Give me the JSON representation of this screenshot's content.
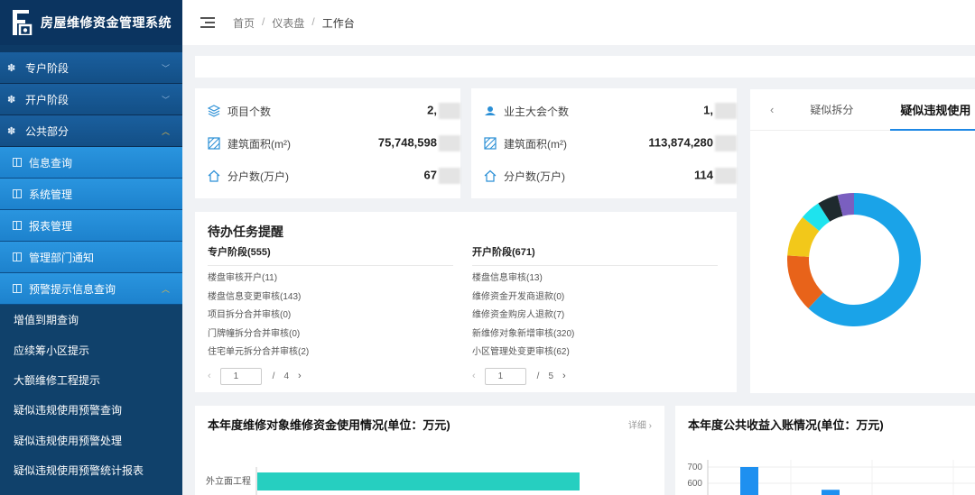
{
  "app": {
    "title": "房屋维修资金管理系统"
  },
  "colors": {
    "primary": "#1e88e5",
    "sidebar": "#10416b",
    "menu_active": "#2a95df",
    "bar_teal": "#26cfc0"
  },
  "sidebar": {
    "top_items": [
      {
        "label": "专户阶段",
        "icon": "gear-icon"
      },
      {
        "label": "开户阶段",
        "icon": "gear-icon"
      },
      {
        "label": "公共部分",
        "icon": "gear-icon",
        "expanded": true
      }
    ],
    "sub_items": [
      {
        "label": "信息查询"
      },
      {
        "label": "系统管理"
      },
      {
        "label": "报表管理"
      },
      {
        "label": "管理部门通知"
      },
      {
        "label": "预警提示信息查询",
        "expanded": true
      }
    ],
    "leaf_items": [
      {
        "label": "增值到期查询"
      },
      {
        "label": "应续筹小区提示"
      },
      {
        "label": "大额维修工程提示"
      },
      {
        "label": "疑似违规使用预警查询"
      },
      {
        "label": "疑似违规使用预警处理"
      },
      {
        "label": "疑似违规使用预警统计报表"
      }
    ]
  },
  "breadcrumb": [
    "首页",
    "仪表盘",
    "工作台"
  ],
  "stats_left": [
    {
      "label": "项目个数",
      "value": "2,",
      "icon": "layers-icon"
    },
    {
      "label": "建筑面积(m²)",
      "value": "75,748,598",
      "icon": "area-icon"
    },
    {
      "label": "分户数(万户)",
      "value": "67",
      "icon": "home-icon"
    }
  ],
  "stats_right": [
    {
      "label": "业主大会个数",
      "value": "1,",
      "icon": "group-icon"
    },
    {
      "label": "建筑面积(m²)",
      "value": "113,874,280",
      "icon": "area-icon"
    },
    {
      "label": "分户数(万户)",
      "value": "114",
      "icon": "home-icon"
    }
  ],
  "tasks": {
    "title": "待办任务提醒",
    "columns": [
      {
        "head": "专户阶段(555)",
        "items": [
          "楼盘审核开户(11)",
          "楼盘信息变更审核(143)",
          "项目拆分合并审核(0)",
          "门牌幢拆分合并审核(0)",
          "住宅单元拆分合并审核(2)"
        ],
        "page": "1",
        "sep": "/",
        "total": "4"
      },
      {
        "head": "开户阶段(671)",
        "items": [
          "楼盘信息审核(13)",
          "维修资金开发商退款(0)",
          "维修资金购房人退款(7)",
          "新维修对象新增审核(320)",
          "小区管理处变更审核(62)"
        ],
        "page": "1",
        "sep": "/",
        "total": "5"
      }
    ]
  },
  "right_panel": {
    "tabs": [
      "疑似拆分",
      "疑似违规使用"
    ],
    "active_tab": 1
  },
  "chart_data": [
    {
      "type": "pie",
      "title": "",
      "donut": true,
      "slices": [
        {
          "value": 62,
          "color": "#1aa3e8"
        },
        {
          "value": 14,
          "color": "#e8631a"
        },
        {
          "value": 10,
          "color": "#f2c81a"
        },
        {
          "value": 5,
          "color": "#1ee3ee"
        },
        {
          "value": 5,
          "color": "#1e2a2e"
        },
        {
          "value": 4,
          "color": "#7a5fc0"
        }
      ]
    },
    {
      "type": "bar",
      "orientation": "horizontal",
      "title": "本年度维修对象维修资金使用情况(单位：万元)",
      "detail_label": "详细 ›",
      "categories": [
        "外立面工程"
      ],
      "values": [
        85
      ],
      "xlim": [
        0,
        100
      ]
    },
    {
      "type": "bar",
      "title": "本年度公共收益入账情况(单位：万元)",
      "yticks": [
        "700",
        "600"
      ],
      "ylim": [
        0,
        700
      ],
      "values": [
        700,
        560
      ]
    }
  ]
}
